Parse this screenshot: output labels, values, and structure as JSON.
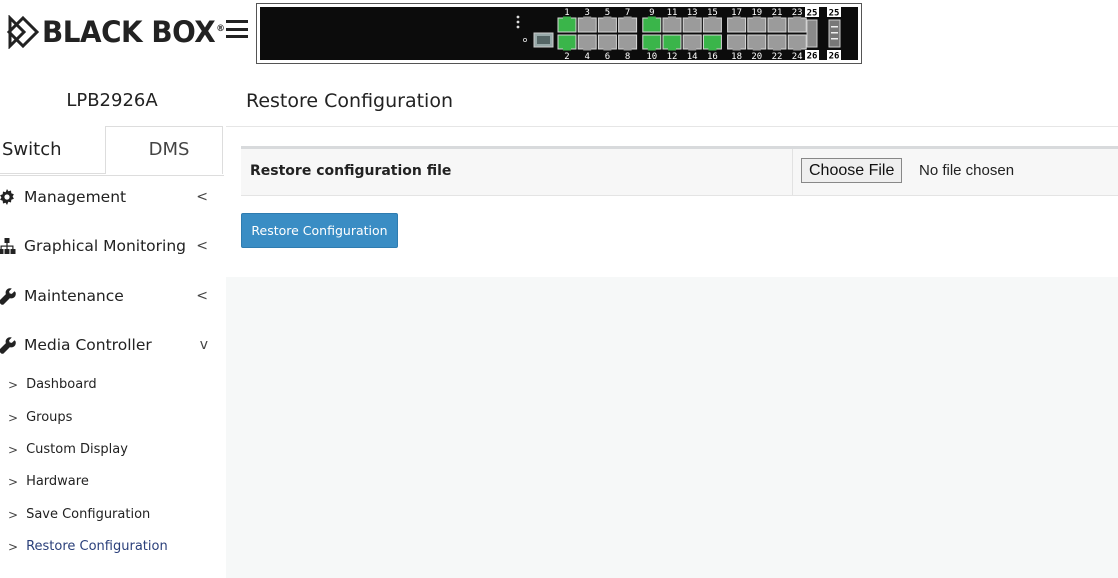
{
  "brand": {
    "logo_text": "BLACK BOX",
    "logo_tm": "®"
  },
  "switch_panel": {
    "top_port_labels": [
      "1",
      "3",
      "5",
      "7",
      "9",
      "11",
      "13",
      "15",
      "17",
      "19",
      "21",
      "23"
    ],
    "bottom_port_labels": [
      "2",
      "4",
      "6",
      "8",
      "10",
      "12",
      "14",
      "16",
      "18",
      "20",
      "22",
      "24"
    ],
    "sfp_top_label": "25",
    "sfp_top_label2": "25",
    "sfp_bottom_label": "26",
    "sfp_bottom_label2": "26",
    "active_ports": [
      "1",
      "2",
      "9",
      "10",
      "12",
      "16"
    ],
    "link_color": "#3ab54a"
  },
  "sidebar": {
    "device_model": "LPB2926A",
    "tabs": [
      {
        "label": "Switch"
      },
      {
        "label": "DMS"
      }
    ],
    "menu": [
      {
        "label": "Management",
        "icon": "gear-icon",
        "chevron": "<"
      },
      {
        "label": "Graphical Monitoring",
        "icon": "sitemap-icon",
        "chevron": "<"
      },
      {
        "label": "Maintenance",
        "icon": "wrench-icon",
        "chevron": "<"
      },
      {
        "label": "Media Controller",
        "icon": "wrench-icon",
        "chevron": "v"
      }
    ],
    "submenu": [
      {
        "label": "Dashboard"
      },
      {
        "label": "Groups"
      },
      {
        "label": "Custom Display"
      },
      {
        "label": "Hardware"
      },
      {
        "label": "Save Configuration"
      },
      {
        "label": "Restore Configuration"
      }
    ]
  },
  "main": {
    "title": "Restore Configuration",
    "form": {
      "label": "Restore configuration file",
      "file_button": "Choose File",
      "file_status": "No file chosen"
    },
    "submit_label": "Restore Configuration"
  },
  "colors": {
    "accent": "#3a8dc4",
    "active_submenu": "#2a3f7a"
  }
}
